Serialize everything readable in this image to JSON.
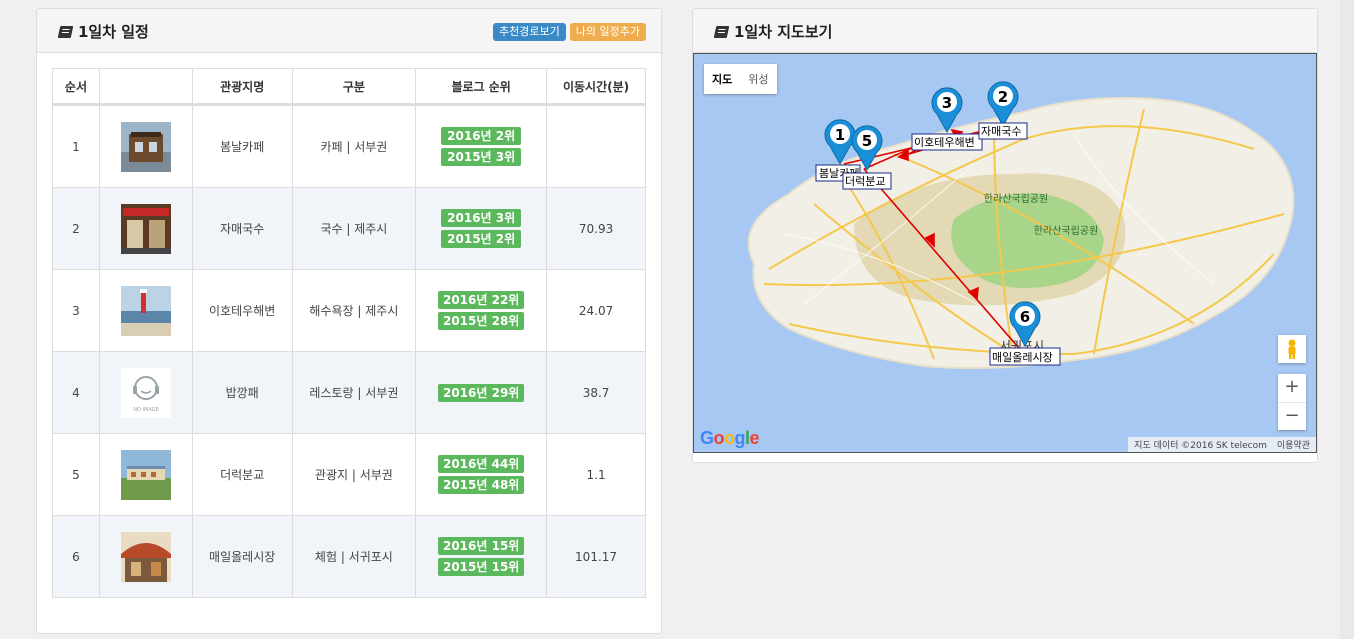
{
  "schedule": {
    "title": "1일차 일정",
    "btn_route": "추천경로보기",
    "btn_add": "나의 일정추가",
    "columns": [
      "순서",
      "",
      "관광지명",
      "구분",
      "블로그 순위",
      "이동시간(분)"
    ],
    "rows": [
      {
        "no": "1",
        "name": "봄날카페",
        "category": "카페 | 서부권",
        "ranks": [
          "2016년 2위",
          "2015년 3위"
        ],
        "time": "",
        "thumb": "cafe-photo"
      },
      {
        "no": "2",
        "name": "자매국수",
        "category": "국수 | 제주시",
        "ranks": [
          "2016년 3위",
          "2015년 2위"
        ],
        "time": "70.93",
        "thumb": "noodle-shop-photo"
      },
      {
        "no": "3",
        "name": "이호테우해변",
        "category": "해수욕장 | 제주시",
        "ranks": [
          "2016년 22위",
          "2015년 28위"
        ],
        "time": "24.07",
        "thumb": "beach-photo"
      },
      {
        "no": "4",
        "name": "밥깡패",
        "category": "레스토랑 | 서부권",
        "ranks": [
          "2016년 29위"
        ],
        "time": "38.7",
        "thumb": "no-image"
      },
      {
        "no": "5",
        "name": "더럭분교",
        "category": "관광지 | 서부권",
        "ranks": [
          "2016년 44위",
          "2015년 48위"
        ],
        "time": "1.1",
        "thumb": "school-photo"
      },
      {
        "no": "6",
        "name": "매일올레시장",
        "category": "체험 | 서귀포시",
        "ranks": [
          "2016년 15위",
          "2015년 15위"
        ],
        "time": "101.17",
        "thumb": "market-photo"
      }
    ],
    "no_image_text": "NO IMAGE"
  },
  "mapview": {
    "title": "1일차 지도보기",
    "maptype_map": "지도",
    "maptype_satellite": "위성",
    "zoom_in": "+",
    "zoom_out": "−",
    "attribution": "지도 데이터 ©2016 SK telecom",
    "terms": "이용약관",
    "google": "Google",
    "park_label_1": "한라산국립공원",
    "park_label_2": "한라산국립공원",
    "markers": [
      {
        "num": "1",
        "label": "봄날카페"
      },
      {
        "num": "2",
        "label": "자매국수"
      },
      {
        "num": "3",
        "label": "이호테우해변"
      },
      {
        "num": "5",
        "label": "더럭분교"
      },
      {
        "num": "6",
        "label": "매일올레시장"
      }
    ],
    "city_label": "서귀포시",
    "colors": {
      "route": "#e00000",
      "pin": "#1a8fd8",
      "water": "#a6c8f2",
      "land": "#f2efe6",
      "park": "#a8d58a"
    }
  }
}
